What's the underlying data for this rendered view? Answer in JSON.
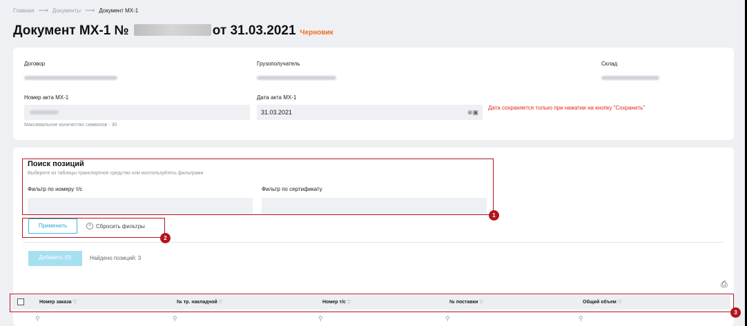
{
  "breadcrumb": {
    "home": "Главная",
    "docs": "Документы",
    "current": "Документ МХ-1",
    "sep": "⟶"
  },
  "header": {
    "title_prefix": "Документ МХ-1 №",
    "title_suffix": "от 31.03.2021",
    "status": "Черновик"
  },
  "form": {
    "contract_label": "Договор",
    "consignee_label": "Грузополучатель",
    "warehouse_label": "Склад",
    "act_number_label": "Номер акта МХ-1",
    "act_number_hint": "Максимальное количество символов - 30",
    "act_date_label": "Дата акта МХ-1",
    "act_date_value": "31.03.2021",
    "date_warning": "Дата сохраняется только при нажатии на кнопку \"Сохранить\""
  },
  "search": {
    "title": "Поиск позиций",
    "subtitle": "Выберите из таблицы транспортное средство или воспользуйтесь фильтрами",
    "vehicle_filter_label": "Фильтр по номеру т/с",
    "cert_filter_label": "Фильтр по сертификату",
    "apply_label": "Применить",
    "reset_label": "Сбросить фильтры"
  },
  "actions": {
    "add_label": "Добавить (0)",
    "found_label": "Найдено позиций: 3"
  },
  "table": {
    "columns": [
      "Номер заказа",
      "№ тр. накладной",
      "Номер т/с",
      "№ поставки",
      "Общий объем"
    ]
  },
  "markers": [
    "1",
    "2",
    "3"
  ],
  "colors": {
    "accent": "#3cb6e2",
    "status": "#f26a1b",
    "warning": "#e2241a",
    "annotation": "#b3151e"
  }
}
